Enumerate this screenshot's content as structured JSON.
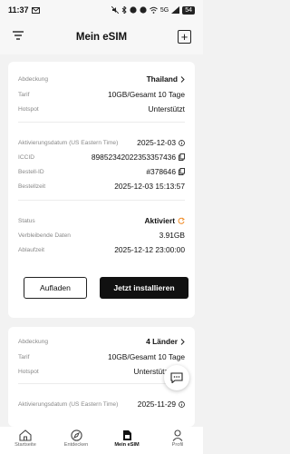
{
  "status_bar": {
    "time": "11:37",
    "indicators": "5G",
    "battery": "54"
  },
  "header": {
    "title": "Mein eSIM",
    "filter_icon": "filter-icon",
    "add_icon": "plus-icon",
    "add_label": "+"
  },
  "esims": [
    {
      "coverage_label": "Abdeckung",
      "coverage_value": "Thailand",
      "plan_label": "Tarif",
      "plan_value": "10GB/Gesamt 10 Tage",
      "hotspot_label": "Hotspot",
      "hotspot_value": "Unterstützt",
      "activation_label": "Aktivierungsdatum (US Eastern Time)",
      "activation_value": "2025-12-03",
      "iccid_label": "ICCID",
      "iccid_value": "89852342022353357436",
      "order_label": "Bestell-ID",
      "order_value": "#378646",
      "order_time_label": "Bestellzeit",
      "order_time_value": "2025-12-03 15:13:57",
      "status_label": "Status",
      "status_value": "Aktiviert",
      "remaining_label": "Verbleibende Daten",
      "remaining_value": "3.91GB",
      "expiry_label": "Ablaufzeit",
      "expiry_value": "2025-12-12 23:00:00",
      "topup_button": "Aufladen",
      "install_button": "Jetzt installieren"
    },
    {
      "coverage_label": "Abdeckung",
      "coverage_value": "4 Länder",
      "plan_label": "Tarif",
      "plan_value": "10GB/Gesamt 10 Tage",
      "hotspot_label": "Hotspot",
      "hotspot_value": "Unterstützt",
      "activation_label": "Aktivierungsdatum (US Eastern Time)",
      "activation_value": "2025-11-29"
    }
  ],
  "bottom_nav": [
    {
      "label": "Startseite",
      "icon": "home-icon"
    },
    {
      "label": "Entdecken",
      "icon": "compass-icon"
    },
    {
      "label": "Mein eSIM",
      "icon": "sim-icon",
      "active": true
    },
    {
      "label": "Profil",
      "icon": "profile-icon"
    }
  ],
  "colors": {
    "accent": "#111111",
    "status_activated_icon": "#f08a24",
    "background": "#f2f2f2",
    "card": "#ffffff"
  }
}
